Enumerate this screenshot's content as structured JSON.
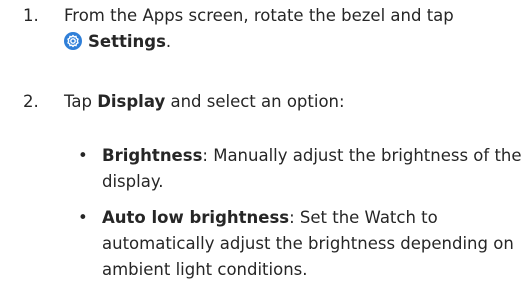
{
  "steps": [
    {
      "number": "1.",
      "text_before": "From the Apps screen, rotate the bezel and tap",
      "icon": "settings-gear-icon",
      "bold": "Settings",
      "text_after": "."
    },
    {
      "number": "2.",
      "text_before": "Tap ",
      "bold": "Display",
      "text_after": " and select an option:"
    }
  ],
  "bullets": [
    {
      "bullet": "•",
      "bold": "Brightness",
      "text": ": Manually adjust the brightness of the display."
    },
    {
      "bullet": "•",
      "bold": "Auto low brightness",
      "text": ": Set the Watch to automatically adjust the brightness depending on ambient light conditions."
    }
  ],
  "colors": {
    "text": "#262626",
    "icon_blue": "#2f7fd8"
  }
}
